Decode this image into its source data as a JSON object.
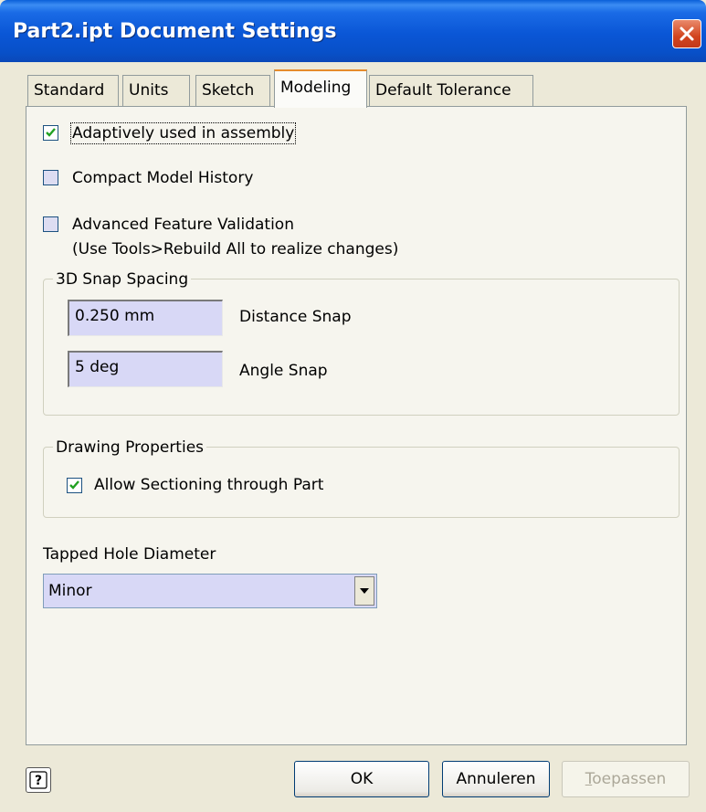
{
  "window": {
    "title": "Part2.ipt Document Settings"
  },
  "tabs": [
    {
      "label": "Standard",
      "active": false
    },
    {
      "label": "Units",
      "active": false
    },
    {
      "label": "Sketch",
      "active": false
    },
    {
      "label": "Modeling",
      "active": true
    },
    {
      "label": "Default Tolerance",
      "active": false
    }
  ],
  "modeling": {
    "adaptive": {
      "label": "Adaptively used in assembly",
      "checked": true
    },
    "compact_history": {
      "label": "Compact Model History",
      "checked": false
    },
    "advanced_validation": {
      "label": "Advanced Feature Validation",
      "note": "(Use Tools>Rebuild All to realize changes)",
      "checked": false
    },
    "snap_spacing": {
      "legend": "3D Snap Spacing",
      "distance": {
        "value": "0.250 mm",
        "label": "Distance Snap"
      },
      "angle": {
        "value": "5 deg",
        "label": "Angle Snap"
      }
    },
    "drawing_properties": {
      "legend": "Drawing Properties",
      "allow_sectioning": {
        "label": "Allow Sectioning through Part",
        "checked": true
      }
    },
    "tapped_hole": {
      "label": "Tapped Hole Diameter",
      "selected": "Minor"
    }
  },
  "buttons": {
    "ok": "OK",
    "cancel": "Annuleren",
    "apply": "Toepassen",
    "apply_enabled": false
  },
  "icons": {
    "close": "close-icon",
    "help": "help-icon",
    "dropdown": "chevron-down-icon"
  }
}
